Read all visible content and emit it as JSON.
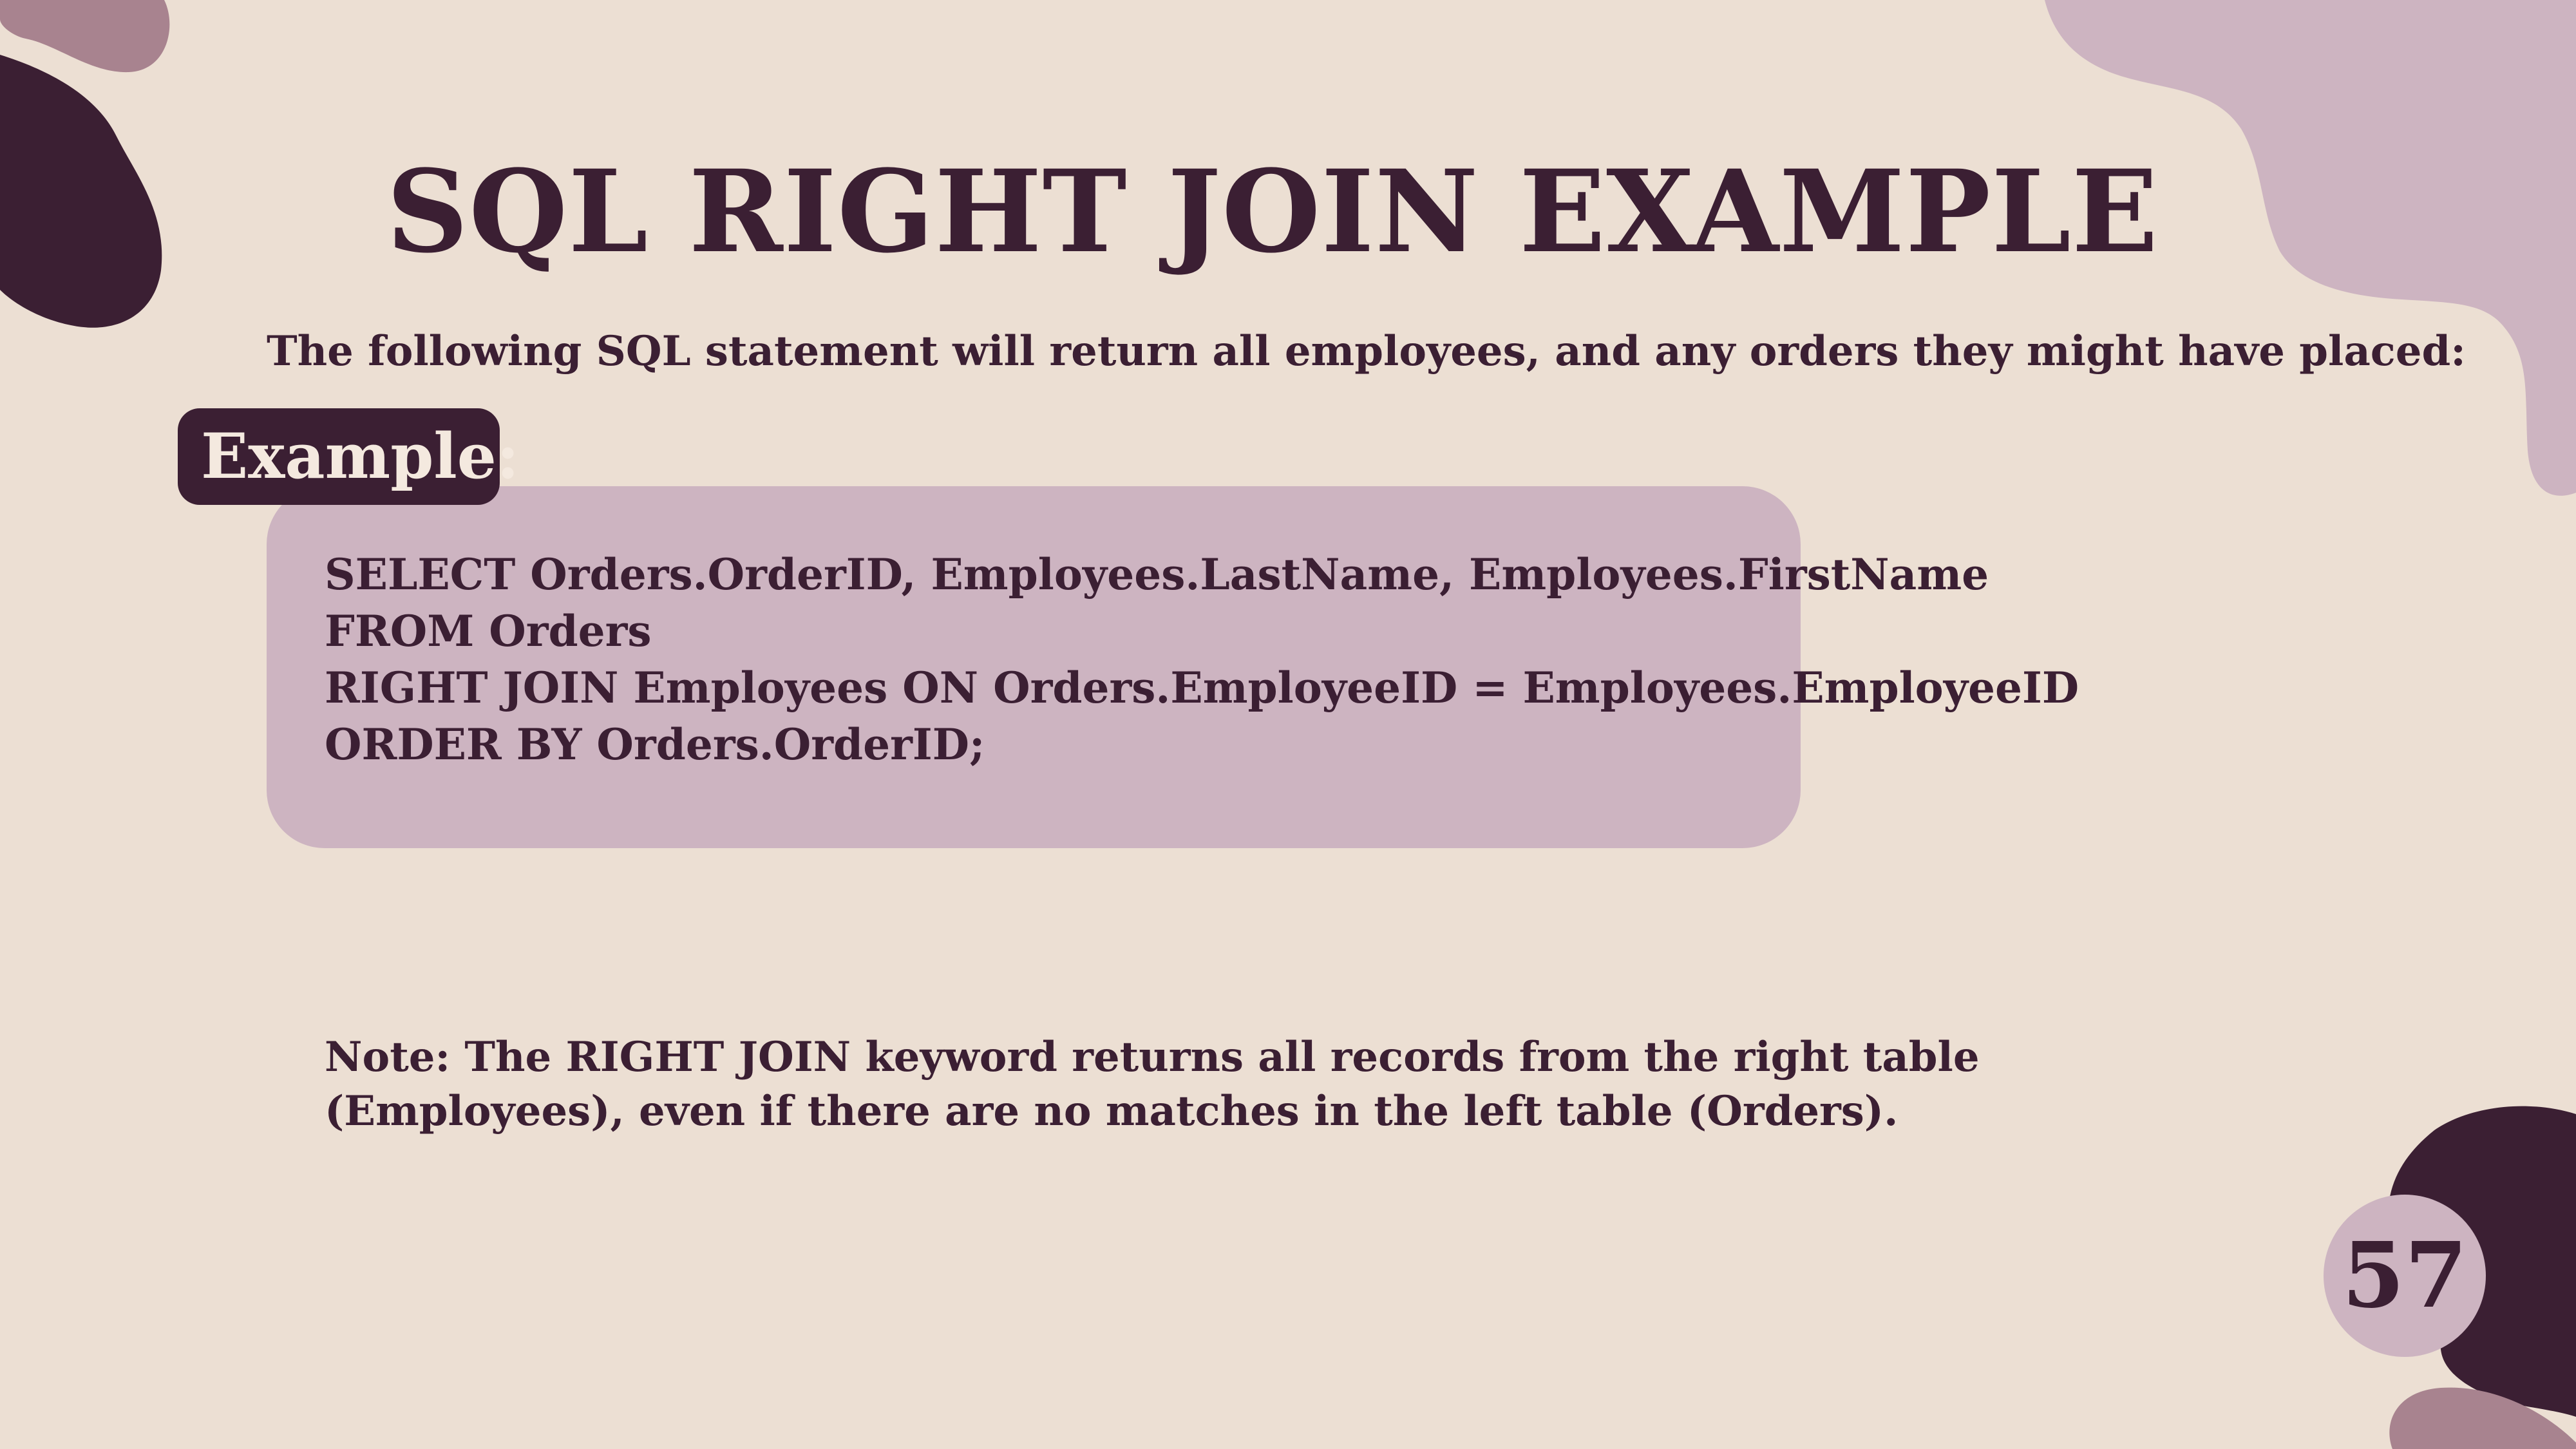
{
  "slide": {
    "title": "SQL RIGHT JOIN EXAMPLE",
    "intro": "The following SQL statement will return all employees, and any orders they might have placed:",
    "example_label": "Example:",
    "code_lines": [
      "SELECT Orders.OrderID, Employees.LastName, Employees.FirstName",
      "FROM Orders",
      "RIGHT JOIN Employees ON Orders.EmployeeID = Employees.EmployeeID",
      "ORDER BY Orders.OrderID;"
    ],
    "note_lines": [
      "Note: The RIGHT JOIN keyword returns all records from the right table",
      "(Employees), even if there are no matches in the left table (Orders)."
    ],
    "page_number": "57"
  },
  "colors": {
    "background": "#ecdfd3",
    "dark_plum": "#3b1f33",
    "light_mauve": "#cdb4c1",
    "mid_mauve": "#a8838f"
  }
}
